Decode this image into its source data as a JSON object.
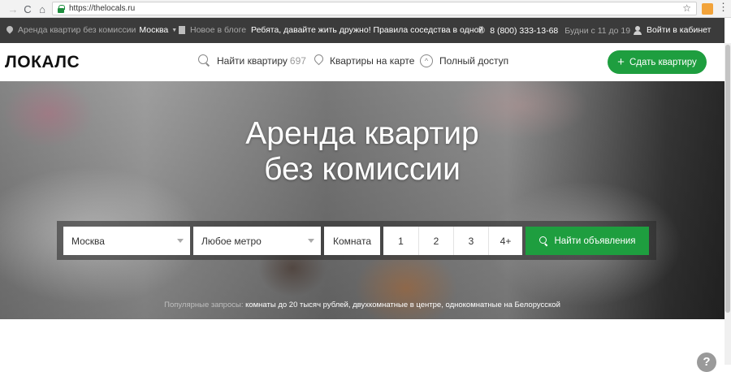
{
  "browser": {
    "back_icon": "→",
    "reload_icon": "C",
    "home_icon": "⌂",
    "url": "https://thelocals.ru",
    "star_icon": "☆",
    "menu_icon": "⋮"
  },
  "topbar": {
    "city_text": "Аренда квартир без комиссии",
    "city": "Москва",
    "blog_label": "Новое в блоге",
    "blog_post": "Ребята, давайте жить дружно! Правила соседства в одной",
    "phone": "8 (800) 333-13-68",
    "hours": "Будни с 11 до 19",
    "login": "Войти в кабинет"
  },
  "header": {
    "logo": "ЛОКАЛС",
    "nav": [
      {
        "label": "Найти квартиру",
        "count": "697"
      },
      {
        "label": "Квартиры на карте"
      },
      {
        "label": "Полный доступ"
      }
    ],
    "add_button": "Сдать квартиру"
  },
  "hero": {
    "title_line1": "Аренда квартир",
    "title_line2": "без комиссии",
    "search": {
      "city": "Москва",
      "metro": "Любое метро",
      "room_label": "Комната",
      "rooms": [
        "1",
        "2",
        "3",
        "4+"
      ],
      "find_button": "Найти объявления"
    },
    "popular_label": "Популярные запросы:",
    "popular_queries": "комнаты до 20 тысяч рублей, двухкомнатные в центре, однокомнатные на Белорусской"
  },
  "help": {
    "icon": "?"
  },
  "colors": {
    "brand_green": "#1e9e3f",
    "topbar_bg": "#3b3b3b"
  }
}
